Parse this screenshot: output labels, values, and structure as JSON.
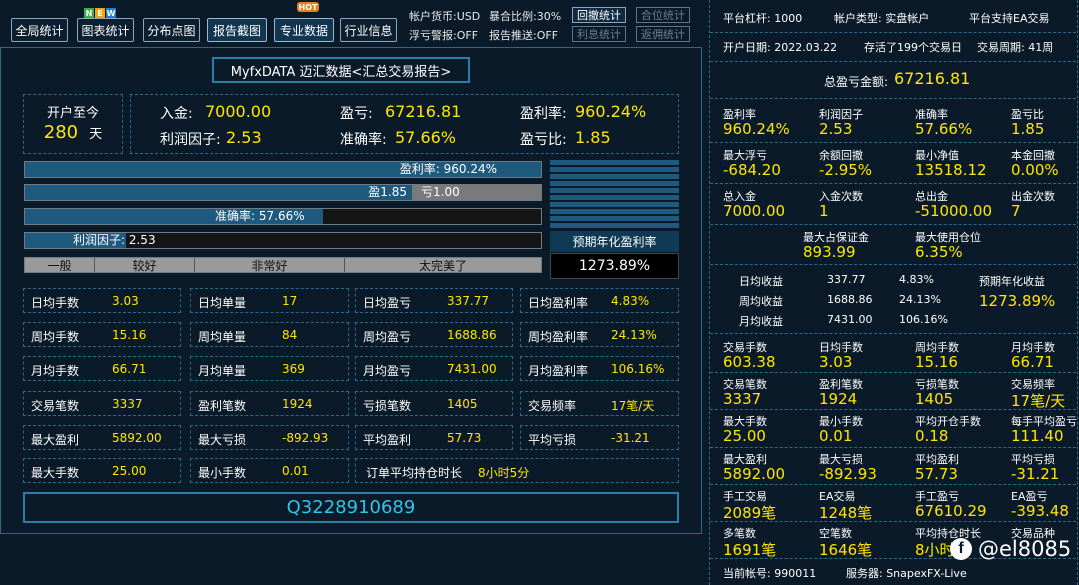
{
  "toolbar": {
    "buttons": [
      "全局统计",
      "图表统计",
      "分布点图",
      "报告截图",
      "专业数据",
      "行业信息"
    ],
    "new_badge": [
      "N",
      "E",
      "W"
    ],
    "hot_badge": "HOT",
    "currency": "帐户货币:USD",
    "float_warn": "浮亏警报:OFF",
    "exposure": "暴合比例:30%",
    "report_push": "报告推送:OFF",
    "right_buttons": [
      "回撤统计",
      "合位统计",
      "利息统计",
      "返佣统计"
    ]
  },
  "main": {
    "title": "MyfxDATA 迈汇数据<汇总交易报告>",
    "since": {
      "label": "开户至今",
      "value": "280",
      "unit": "天"
    },
    "summary": [
      {
        "label": "入金:",
        "value": "7000.00"
      },
      {
        "label": "盈亏:",
        "value": "67216.81"
      },
      {
        "label": "盈利率:",
        "value": "960.24%"
      },
      {
        "label": "利润因子:",
        "value": "2.53"
      },
      {
        "label": "准确率:",
        "value": "57.66%"
      },
      {
        "label": "盈亏比:",
        "value": "1.85"
      }
    ],
    "bars": {
      "profit_rate": {
        "text": "盈利率:  960.24%",
        "level": 1.0
      },
      "win": {
        "text": "盈1.85",
        "level": 0.75
      },
      "loss": {
        "text": "亏1.00"
      },
      "accuracy": {
        "text": "准确率:  57.66%",
        "level": 0.5766
      },
      "factor": {
        "text": "利润因子:  2.53",
        "level": 0.195
      }
    },
    "grades": [
      "一般",
      "较好",
      "非常好",
      "太完美了"
    ],
    "annual": {
      "label": "预期年化盈利率",
      "value": "1273.89%"
    },
    "stats": [
      [
        [
          "日均手数",
          "3.03"
        ],
        [
          "日均单量",
          "17"
        ],
        [
          "日均盈亏",
          "337.77"
        ],
        [
          "日均盈利率",
          "4.83%"
        ]
      ],
      [
        [
          "周均手数",
          "15.16"
        ],
        [
          "周均单量",
          "84"
        ],
        [
          "周均盈亏",
          "1688.86"
        ],
        [
          "周均盈利率",
          "24.13%"
        ]
      ],
      [
        [
          "月均手数",
          "66.71"
        ],
        [
          "月均单量",
          "369"
        ],
        [
          "月均盈亏",
          "7431.00"
        ],
        [
          "月均盈利率",
          "106.16%"
        ]
      ],
      [
        [
          "交易笔数",
          "3337"
        ],
        [
          "盈利笔数",
          "1924"
        ],
        [
          "亏损笔数",
          "1405"
        ],
        [
          "交易频率",
          "17笔/天"
        ]
      ],
      [
        [
          "最大盈利",
          "5892.00"
        ],
        [
          "最大亏损",
          "-892.93"
        ],
        [
          "平均盈利",
          "57.73"
        ],
        [
          "平均亏损",
          "-31.21"
        ]
      ]
    ],
    "last_row": [
      [
        "最大手数",
        "25.00"
      ],
      [
        "最小手数",
        "0.01"
      ]
    ],
    "hold": {
      "label": "订单平均持仓时长",
      "value": "8小时5分"
    },
    "account_id": "Q3228910689"
  },
  "right": {
    "leverage": "平台杠杆:  1000",
    "account_type": "帐户类型:  实盘帐户",
    "ea_support": "平台支持EA交易",
    "open_date": "开户日期:  2022.03.22",
    "alive": "存活了199个交易日",
    "cycle": "交易周期:  41周",
    "total_label": "总盈亏金额:",
    "total_value": "67216.81",
    "grid1": [
      [
        [
          "盈利率",
          "960.24%"
        ],
        [
          "利润因子",
          "2.53"
        ],
        [
          "准确率",
          "57.66%"
        ],
        [
          "盈亏比",
          "1.85"
        ]
      ],
      [
        [
          "最大浮亏",
          "-684.20"
        ],
        [
          "余额回撤",
          "-2.95%"
        ],
        [
          "最小净值",
          "13518.12"
        ],
        [
          "本金回撤",
          "0.00%"
        ]
      ],
      [
        [
          "总入金",
          "7000.00"
        ],
        [
          "入金次数",
          "1"
        ],
        [
          "总出金",
          "-51000.00"
        ],
        [
          "出金次数",
          "7"
        ]
      ]
    ],
    "margin": [
      [
        "最大占保证金",
        "893.99"
      ],
      [
        "最大使用仓位",
        "6.35%"
      ]
    ],
    "avg_rows": [
      [
        "日均收益",
        "337.77",
        "4.83%"
      ],
      [
        "周均收益",
        "1688.86",
        "24.13%"
      ],
      [
        "月均收益",
        "7431.00",
        "106.16%"
      ]
    ],
    "annual_label": "预期年化收益",
    "annual_value": "1273.89%",
    "grid2": [
      [
        [
          "交易手数",
          "603.38"
        ],
        [
          "日均手数",
          "3.03"
        ],
        [
          "周均手数",
          "15.16"
        ],
        [
          "月均手数",
          "66.71"
        ]
      ],
      [
        [
          "交易笔数",
          "3337"
        ],
        [
          "盈利笔数",
          "1924"
        ],
        [
          "亏损笔数",
          "1405"
        ],
        [
          "交易频率",
          "17笔/天"
        ]
      ],
      [
        [
          "最大手数",
          "25.00"
        ],
        [
          "最小手数",
          "0.01"
        ],
        [
          "平均开仓手数",
          "0.18"
        ],
        [
          "每手平均盈亏",
          "111.40"
        ]
      ],
      [
        [
          "最大盈利",
          "5892.00"
        ],
        [
          "最大亏损",
          "-892.93"
        ],
        [
          "平均盈利",
          "57.73"
        ],
        [
          "平均亏损",
          "-31.21"
        ]
      ],
      [
        [
          "手工交易",
          "2089笔"
        ],
        [
          "EA交易",
          "1248笔"
        ],
        [
          "手工盈亏",
          "67610.29"
        ],
        [
          "EA盈亏",
          "-393.48"
        ]
      ],
      [
        [
          "多笔数",
          "1691笔"
        ],
        [
          "空笔数",
          "1646笔"
        ],
        [
          "平均持仓时长",
          "8小时"
        ],
        [
          "交易品种",
          ""
        ]
      ]
    ],
    "account_no": "当前帐号:  990011",
    "server": "服务器:  SnapexFX-Live"
  },
  "watermark": {
    "handle": "@el8085"
  },
  "colors": {
    "accent_yellow": "#ffe600",
    "bar_blue": "#1e5a7e",
    "border": "#2a6a88",
    "teal_text": "#2ec6e8"
  }
}
